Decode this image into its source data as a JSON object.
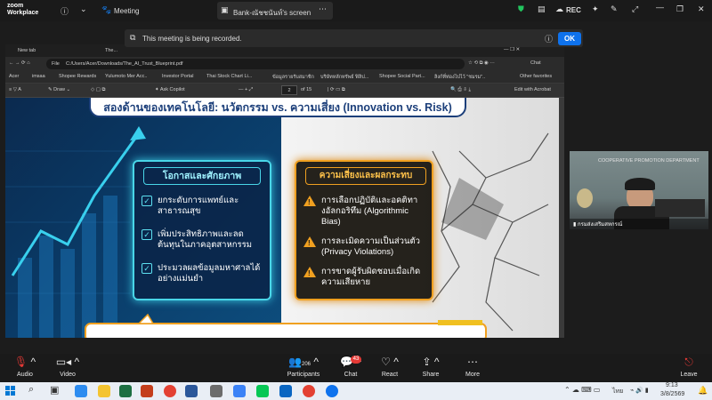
{
  "zoom": {
    "logo_line1": "zoom",
    "logo_line2": "Workplace",
    "meeting_label": "Meeting",
    "share_tab_label": "Bank-ณัชชนันท์'s screen",
    "rec_label": "REC",
    "recording_banner": "This meeting is being recorded.",
    "ok_label": "OK",
    "participant_name": "กรมส่งเสริมสหกรณ์",
    "participant_bg_text": "COOPERATIVE PROMOTION DEPARTMENT",
    "controls": [
      {
        "icon": "mic-off-icon",
        "label": "Audio"
      },
      {
        "icon": "video-icon",
        "label": "Video"
      },
      {
        "icon": "participants-icon",
        "label": "Participants",
        "count": "206"
      },
      {
        "icon": "chat-icon",
        "label": "Chat",
        "badge": "43"
      },
      {
        "icon": "react-icon",
        "label": "React"
      },
      {
        "icon": "share-icon",
        "label": "Share"
      },
      {
        "icon": "more-icon",
        "label": "More"
      },
      {
        "icon": "leave-icon",
        "label": "Leave"
      }
    ]
  },
  "browser": {
    "tabs": [
      "New tab",
      "The..."
    ],
    "address": "C:/Users/Acer/Downloads/The_AI_Trust_Blueprint.pdf",
    "address_prefix": "File",
    "chat_label": "Chat",
    "bookmarks": [
      "Acer",
      "imsaa",
      "Shopee Rewards",
      "Yulumoto Mer Acc..",
      "Investor Portal",
      "Thai Stock Chart Li...",
      "ข้อมูลรายรับสมาชิก",
      "บริษัทหลักทรัพย์ ฟิลิป...",
      "Shopee Social Part...",
      "ลิงก์ที่ท่องไปไว้ \"ชมรม\"..",
      "Other favorites"
    ],
    "pdf_toolbar": {
      "draw": "Draw",
      "ask_copilot": "Ask Copilot",
      "page_current": "2",
      "page_total": "of 15",
      "edit_acrobat": "Edit with Acrobat"
    }
  },
  "slide": {
    "title": "สองด้านของเทคโนโลยี: นวัตกรรม vs. ความเสี่ยง (Innovation vs. Risk)",
    "opportunity": {
      "title": "โอกาสและศักยภาพ",
      "items": [
        "ยกระดับการแพทย์และสาธารณสุข",
        "เพิ่มประสิทธิภาพและลดต้นทุนในภาคอุตสาหกรรม",
        "ประมวลผลข้อมูลมหาศาลได้อย่างแม่นยำ"
      ]
    },
    "risk": {
      "title": "ความเสี่ยงและผลกระทบ",
      "items": [
        "การเลือกปฏิบัติและอคติทางอัลกอริทึม (Algorithmic Bias)",
        "การละเมิดความเป็นส่วนตัว (Privacy Violations)",
        "การขาดผู้รับผิดชอบเมื่อเกิดความเสียหาย"
      ]
    }
  },
  "taskbar": {
    "time": "9:13",
    "date": "3/8/2569",
    "lang": "ไทย"
  },
  "colors": {
    "accent": "#0e72ed",
    "opportunity": "#49d6e8",
    "risk": "#f0a020",
    "title": "#1c3f7a"
  }
}
